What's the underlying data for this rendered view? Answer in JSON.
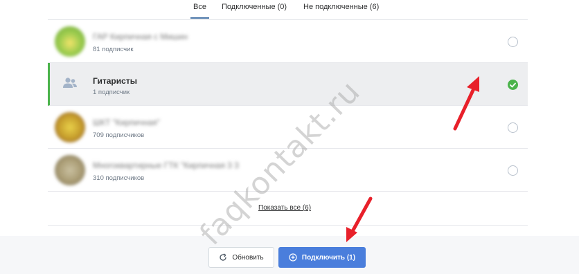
{
  "tabs": [
    {
      "label": "Все"
    },
    {
      "label": "Подключенные (0)"
    },
    {
      "label": "Не подключенные (6)"
    }
  ],
  "groups": [
    {
      "name": "ГАР Кирпичная с Мишин",
      "subscribers": "81 подписчик",
      "avatar_color": "#8fc04a",
      "selected": false
    },
    {
      "name": "Гитаристы",
      "subscribers": "1 подписчик",
      "avatar_icon": "users-icon",
      "selected": true
    },
    {
      "name": "ШКТ \"Кирпичная\"",
      "subscribers": "709 подписчиков",
      "avatar_color": "#d4b12e",
      "selected": false
    },
    {
      "name": "Многоквартирные ГТК \"Кирпичная 3 3",
      "subscribers": "310 подписчиков",
      "avatar_color": "#9b9070",
      "selected": false
    }
  ],
  "show_all": "Показать все (6)",
  "buttons": {
    "refresh": "Обновить",
    "connect": "Подключить (1)"
  },
  "watermark": "faqkontakt.ru",
  "colors": {
    "accent": "#4a7edc",
    "check": "#4bb34b",
    "arrow": "#e8202a"
  }
}
